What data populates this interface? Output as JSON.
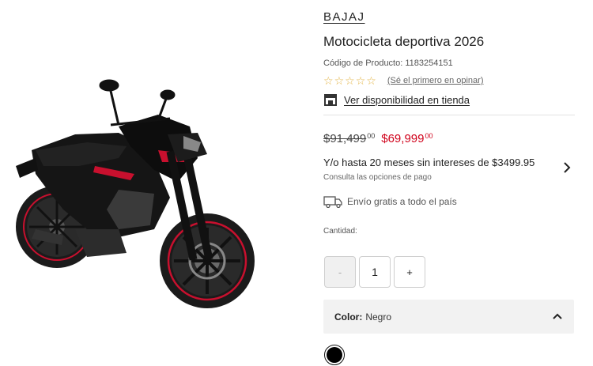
{
  "product": {
    "brand": "BAJAJ",
    "title": "Motocicleta deportiva 2026",
    "sku_text": "Código de Producto: 1183254151",
    "image_alt": "motorcycle-image"
  },
  "rating": {
    "stars": [
      "☆",
      "☆",
      "☆",
      "☆",
      "☆"
    ],
    "prompt": "(Sé el primero en opinar)"
  },
  "store": {
    "icon": "store-icon",
    "link": "Ver disponibilidad en tienda"
  },
  "price": {
    "old_main": "$91,499",
    "old_cents": "00",
    "new_main": "$69,999",
    "new_cents": "00",
    "sale_color": "#d0021b"
  },
  "installments": {
    "text": "Y/o hasta 20 meses sin intereses de $3499.95",
    "subtext": "Consulta las opciones de pago",
    "icon": "chevron-right-icon"
  },
  "shipping": {
    "icon": "truck-icon",
    "text": "Envío gratis a todo el país"
  },
  "quantity": {
    "label": "Cantidad:",
    "decrement": "-",
    "value": "1",
    "increment": "+"
  },
  "color": {
    "key": "Color:",
    "value": "Negro",
    "swatch": "#000000",
    "icon": "chevron-up-icon"
  }
}
